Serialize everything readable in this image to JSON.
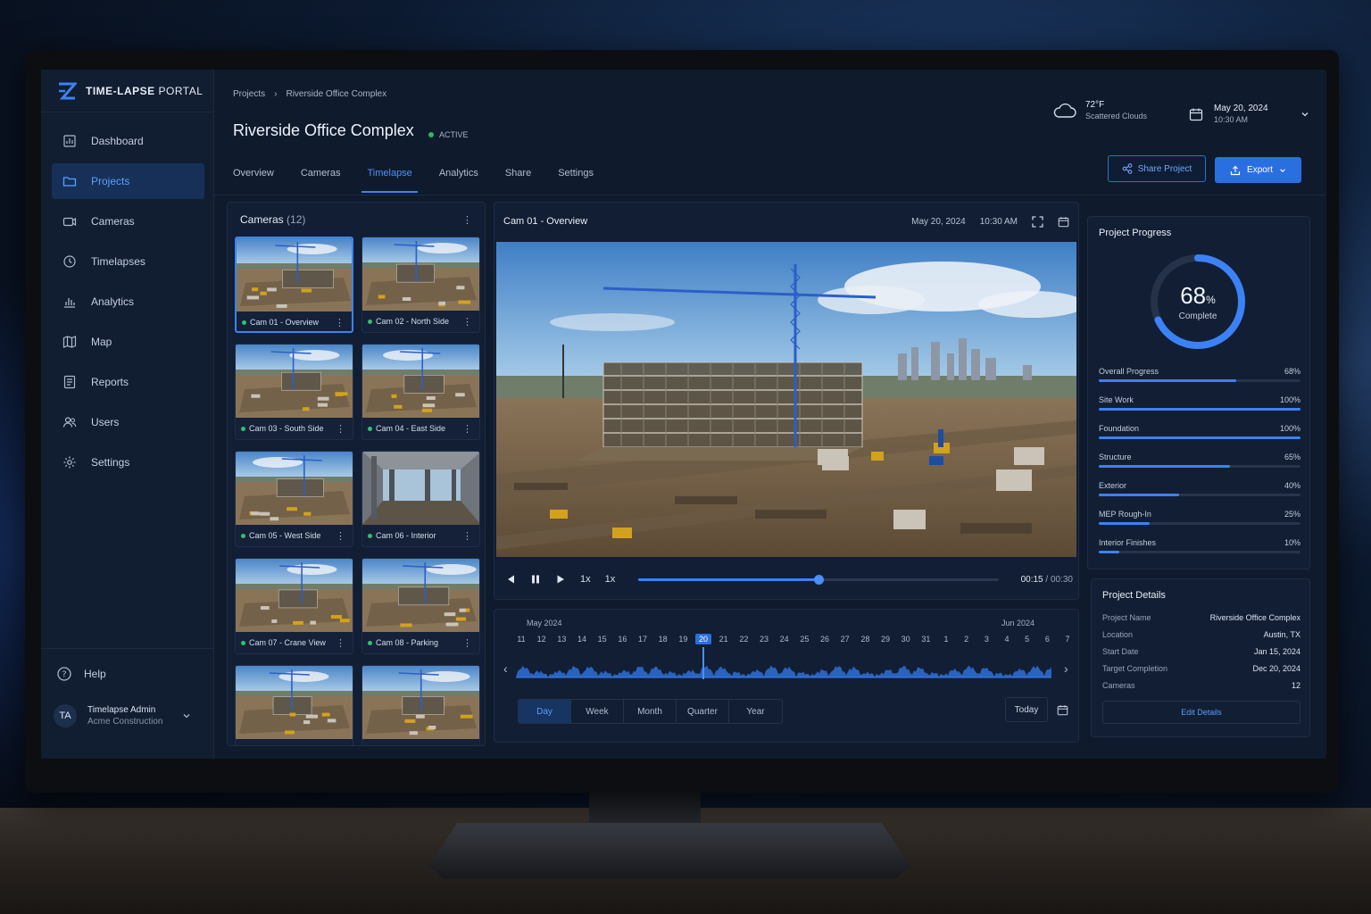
{
  "app": {
    "brand": "TIME-LAPSE",
    "brand_suffix": "PORTAL"
  },
  "sidebar": {
    "items": [
      {
        "label": "Dashboard",
        "icon": "dashboard-icon"
      },
      {
        "label": "Projects",
        "icon": "folder-icon",
        "active": true
      },
      {
        "label": "Cameras",
        "icon": "camera-icon"
      },
      {
        "label": "Timelapses",
        "icon": "timelapse-icon"
      },
      {
        "label": "Analytics",
        "icon": "analytics-icon"
      },
      {
        "label": "Map",
        "icon": "map-icon"
      },
      {
        "label": "Reports",
        "icon": "reports-icon"
      },
      {
        "label": "Users",
        "icon": "users-icon"
      },
      {
        "label": "Settings",
        "icon": "gear-icon"
      }
    ],
    "help": "Help",
    "user": {
      "initials": "TA",
      "name": "Timelapse Admin",
      "org": "Acme Construction"
    }
  },
  "header": {
    "breadcrumb": [
      "Projects",
      "Riverside Office Complex"
    ],
    "title": "Riverside Office Complex",
    "status": "ACTIVE",
    "weather": {
      "temp": "72°F",
      "desc": "Scattered Clouds"
    },
    "date": "May 20, 2024",
    "time": "10:30 AM",
    "tabs": [
      "Overview",
      "Cameras",
      "Timelapse",
      "Analytics",
      "Share",
      "Settings"
    ],
    "active_tab": "Timelapse",
    "share_label": "Share Project",
    "export_label": "Export"
  },
  "cameras": {
    "title": "Cameras",
    "count": "(12)",
    "items": [
      {
        "label": "Cam 01 - Overview",
        "selected": true
      },
      {
        "label": "Cam 02 - North Side"
      },
      {
        "label": "Cam 03 - South Side"
      },
      {
        "label": "Cam 04 - East Side"
      },
      {
        "label": "Cam 05 - West Side"
      },
      {
        "label": "Cam 06 - Interior"
      },
      {
        "label": "Cam 07 - Crane View"
      },
      {
        "label": "Cam 08 - Parking"
      }
    ]
  },
  "player": {
    "title": "Cam 01 - Overview",
    "date": "May 20, 2024",
    "time": "10:30 AM",
    "speed1": "1x",
    "speed2": "1x",
    "current": "00:15",
    "total": "/ 00:30",
    "progress": 0.5
  },
  "timeline": {
    "month_left": "May 2024",
    "month_right": "Jun 2024",
    "days": [
      "11",
      "12",
      "13",
      "14",
      "15",
      "16",
      "17",
      "18",
      "19",
      "20",
      "21",
      "22",
      "23",
      "24",
      "25",
      "26",
      "27",
      "28",
      "29",
      "30",
      "31",
      "1",
      "2",
      "3",
      "4",
      "5",
      "6",
      "7"
    ],
    "selected_day": "20",
    "ranges": [
      "Day",
      "Week",
      "Month",
      "Quarter",
      "Year"
    ],
    "active_range": "Day",
    "today_label": "Today"
  },
  "progress": {
    "title": "Project Progress",
    "percent": "68",
    "percent_sign": "%",
    "caption": "Complete",
    "value": 0.68,
    "items": [
      {
        "label": "Overall Progress",
        "value": "68%",
        "fraction": 0.68
      },
      {
        "label": "Site Work",
        "value": "100%",
        "fraction": 1.0
      },
      {
        "label": "Foundation",
        "value": "100%",
        "fraction": 1.0
      },
      {
        "label": "Structure",
        "value": "65%",
        "fraction": 0.65
      },
      {
        "label": "Exterior",
        "value": "40%",
        "fraction": 0.4
      },
      {
        "label": "MEP Rough-In",
        "value": "25%",
        "fraction": 0.25
      },
      {
        "label": "Interior Finishes",
        "value": "10%",
        "fraction": 0.1
      }
    ]
  },
  "details": {
    "title": "Project Details",
    "rows": [
      {
        "key": "Project Name",
        "value": "Riverside Office Complex"
      },
      {
        "key": "Location",
        "value": "Austin, TX"
      },
      {
        "key": "Start Date",
        "value": "Jan 15, 2024"
      },
      {
        "key": "Target Completion",
        "value": "Dec 20, 2024"
      },
      {
        "key": "Cameras",
        "value": "12"
      }
    ],
    "edit_label": "Edit Details"
  },
  "colors": {
    "accent": "#3b82f6",
    "status_active": "#2fb565",
    "bg": "#0f1a2c"
  }
}
